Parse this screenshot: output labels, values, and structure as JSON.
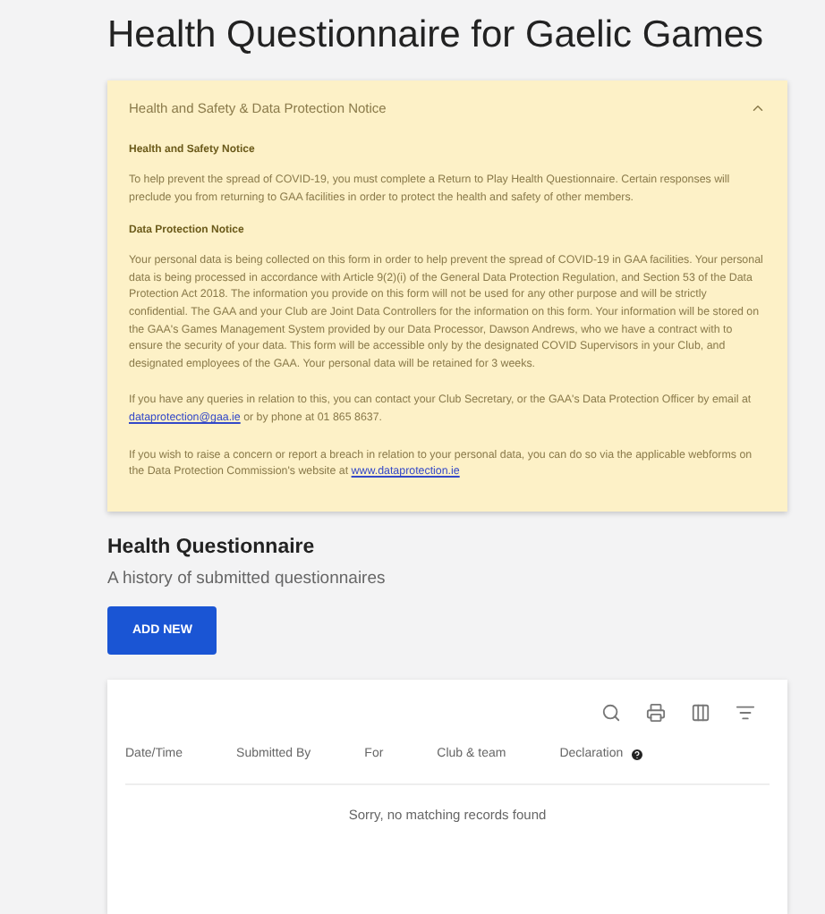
{
  "page_title": "Health Questionnaire for Gaelic Games",
  "notice": {
    "title": "Health and Safety & Data Protection Notice",
    "expanded": true,
    "sections": [
      {
        "kind": "heading",
        "text": "Health and Safety Notice"
      },
      {
        "kind": "paragraph",
        "text": "To help prevent the spread of COVID-19, you must complete a Return to Play Health Questionnaire. Certain responses will preclude you from returning to GAA facilities in order to protect the health and safety of other members."
      },
      {
        "kind": "heading",
        "text": "Data Protection Notice"
      },
      {
        "kind": "paragraph",
        "text": "Your personal data is being collected on this form in order to help prevent the spread of COVID-19 in GAA facilities. Your personal data is being processed in accordance with Article 9(2)(i) of the General Data Protection Regulation, and Section 53 of the Data Protection Act 2018. The information you provide on this form will not be used for any other purpose and will be strictly confidential. The GAA and your Club are Joint Data Controllers for the information on this form. Your information will be stored on the GAA's Games Management System provided by our Data Processor, Dawson Andrews, who we have a contract with to ensure the security of your data. This form will be accessible only by the designated COVID Supervisors in your Club, and designated employees of the GAA. Your personal data will be retained for 3 weeks."
      },
      {
        "kind": "linked",
        "before": "If you have any queries in relation to this, you can contact your Club Secretary, or the GAA's Data Protection Officer by email at ",
        "link": "dataprotection@gaa.ie",
        "after": " or by phone at 01 865 8637."
      },
      {
        "kind": "linked",
        "before": "If you wish to raise a concern or report a breach in relation to your personal data, you can do so via the applicable webforms on the Data Protection Commission's website at ",
        "link": "www.dataprotection.ie"
      }
    ]
  },
  "section": {
    "title": "Health Questionnaire",
    "subtitle": "A history of submitted questionnaires",
    "button": "ADD NEW"
  },
  "table": {
    "columns": [
      {
        "label": "Date/Time",
        "help": false
      },
      {
        "label": "Submitted By",
        "help": false
      },
      {
        "label": "For",
        "help": false
      },
      {
        "label": "Club & team",
        "help": false
      },
      {
        "label": "Declaration",
        "help": true
      }
    ],
    "empty_message": "Sorry, no matching records found"
  }
}
